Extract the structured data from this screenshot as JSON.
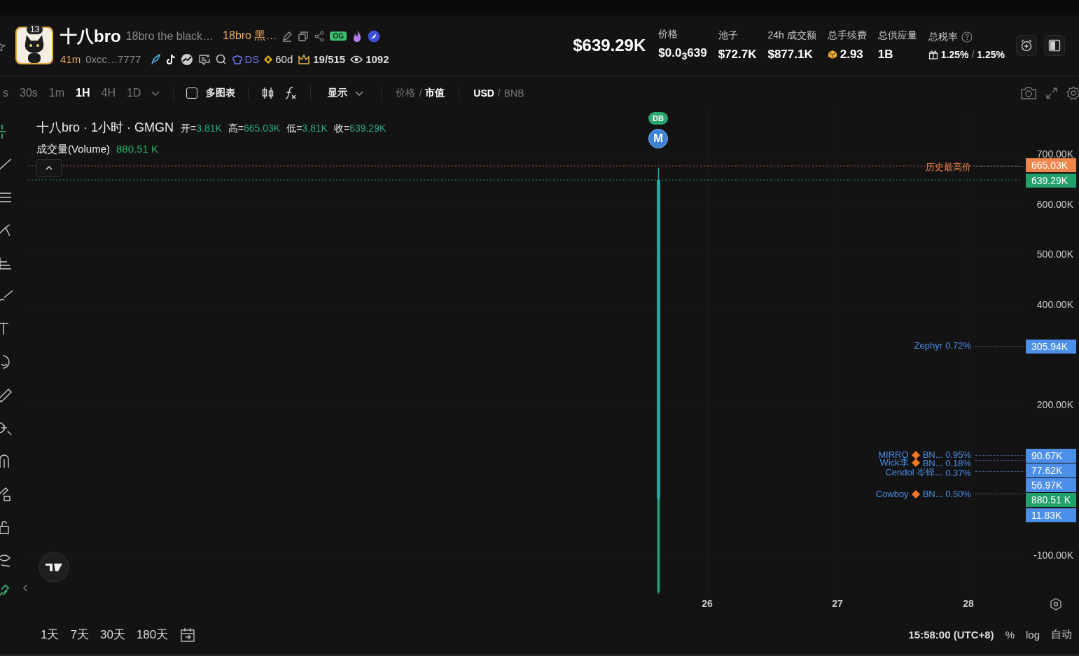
{
  "header": {
    "badge_count": "13",
    "name": "十八bro",
    "full_name": "18bro the black…",
    "alias": "18bro 黑…",
    "og_badge": "OG",
    "age": "41m",
    "address": "0xcc…7777",
    "ds": "DS",
    "days": "60d",
    "holders": "19/515",
    "views": "1092"
  },
  "stats": {
    "market_cap": "$639.29K",
    "items": [
      {
        "kind": "plain",
        "label": "价格",
        "value": "$0.0$_{3}$639"
      },
      {
        "kind": "plain",
        "label": "池子",
        "value": "$72.7K"
      },
      {
        "kind": "plain",
        "label": "24h 成交额",
        "value": "$877.1K"
      },
      {
        "kind": "coin",
        "label": "总手续费",
        "value": "2.93"
      },
      {
        "kind": "plain",
        "label": "总供应量",
        "value": "1B"
      },
      {
        "kind": "tax",
        "label": "总税率",
        "value": "1.25%",
        "sep": "/",
        "value2": "1.25%"
      }
    ]
  },
  "toolbar": {
    "intervals": [
      {
        "label": "s",
        "selected": false
      },
      {
        "label": "30s",
        "selected": false
      },
      {
        "label": "1m",
        "selected": false
      },
      {
        "label": "1H",
        "selected": true
      },
      {
        "label": "4H",
        "selected": false
      },
      {
        "label": "1D",
        "selected": false
      }
    ],
    "multi_chart": {
      "label": "多图表",
      "checked": false
    },
    "display": "显示",
    "price_mode": [
      {
        "label": "价格",
        "selected": false
      },
      {
        "sep": "/",
        "label": "市值",
        "selected": true
      }
    ],
    "currency": [
      {
        "label": "USD",
        "selected": true
      },
      {
        "sep": "/",
        "label": "BNB",
        "selected": false
      }
    ]
  },
  "legend": {
    "title": "十八bro · 1小时 · GMGN",
    "ohlc": [
      {
        "label": "开=",
        "value": "3.81K"
      },
      {
        "label": "高=",
        "value": "665.03K"
      },
      {
        "label": "低=",
        "value": "3.81K"
      },
      {
        "label": "收=",
        "value": "639.29K"
      }
    ],
    "volume_label": "成交量(Volume)",
    "volume_value": "880.51 K"
  },
  "markers": [
    {
      "label": "DB",
      "color": "#2ea66f"
    },
    {
      "label": "M",
      "color": "#3b82d6"
    }
  ],
  "price_axis": [
    "700.00K",
    "600.00K",
    "500.00K",
    "400.00K",
    "200.00K",
    "-100.00K"
  ],
  "line_labels": [
    {
      "kind": "ath",
      "name": "历史最高价"
    },
    {
      "kind": "trader",
      "name": "Zephyr",
      "diamond": false,
      "detail": "0.72%"
    },
    {
      "kind": "trader",
      "name": "MIRRO",
      "diamond": true,
      "detail": "BN... 0.95%"
    },
    {
      "kind": "trader",
      "name": "Wick李",
      "diamond": true,
      "detail": "BN... 0.18%"
    },
    {
      "kind": "trader",
      "name": "Cendol 岑铎...",
      "diamond": false,
      "detail": "0.37%"
    },
    {
      "kind": "trader",
      "name": "Cowboy",
      "diamond": true,
      "detail": "BN... 0.50%"
    }
  ],
  "price_tags": [
    {
      "label": "665.03K",
      "color": "#f0854c"
    },
    {
      "label": "639.29K",
      "color": "#22a06b"
    },
    {
      "label": "305.94K",
      "color": "#4c8fe8"
    },
    {
      "label": "90.67K",
      "color": "#4c8fe8"
    },
    {
      "label": "77.62K",
      "color": "#4c8fe8"
    },
    {
      "label": "56.97K",
      "color": "#4c8fe8"
    },
    {
      "label": "880.51 K",
      "color": "#22a06b"
    },
    {
      "label": "11.83K",
      "color": "#4c8fe8"
    }
  ],
  "x_axis": [
    "26",
    "27",
    "28"
  ],
  "ranges": [
    "1天",
    "7天",
    "30天",
    "180天"
  ],
  "footer": {
    "time": "15:58:00 (UTC+8)",
    "percent": "%",
    "log": "log",
    "auto": "自动"
  }
}
